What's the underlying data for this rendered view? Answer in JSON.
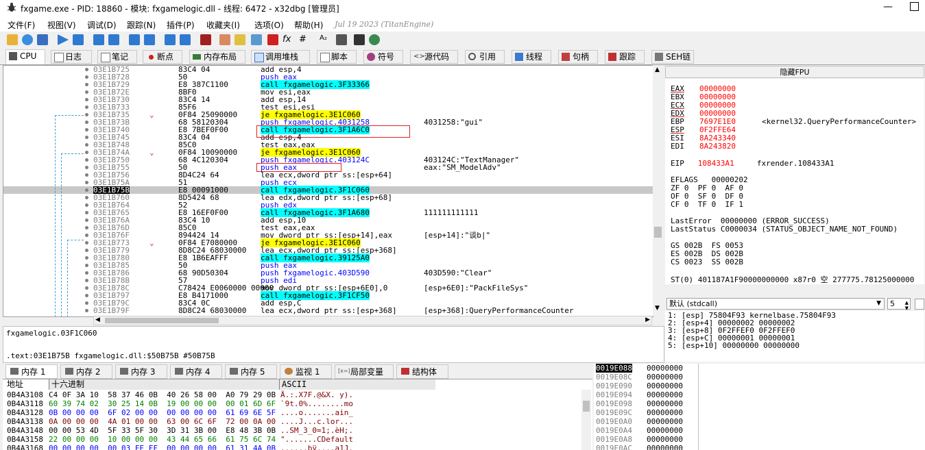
{
  "window": {
    "title": "fxgame.exe - PID: 18860 - 模块: fxgamelogic.dll - 线程: 6472 - x32dbg [管理员]"
  },
  "menu": {
    "items": [
      "文件(F)",
      "视图(V)",
      "调试(D)",
      "跟踪(N)",
      "插件(P)",
      "收藏夹(I)",
      "选项(O)",
      "帮助(H)"
    ],
    "build_date": "Jul 19 2023 (TitanEngine)"
  },
  "tabs": [
    {
      "label": "CPU",
      "icon": "cpu-icon"
    },
    {
      "label": "日志",
      "icon": "log-icon"
    },
    {
      "label": "笔记",
      "icon": "notes-icon"
    },
    {
      "label": "断点",
      "icon": "breakpoint-icon"
    },
    {
      "label": "内存布局",
      "icon": "memory-map-icon"
    },
    {
      "label": "调用堆栈",
      "icon": "call-stack-icon"
    },
    {
      "label": "脚本",
      "icon": "script-icon"
    },
    {
      "label": "符号",
      "icon": "symbols-icon"
    },
    {
      "label": "源代码",
      "icon": "source-icon"
    },
    {
      "label": "引用",
      "icon": "references-icon"
    },
    {
      "label": "线程",
      "icon": "threads-icon"
    },
    {
      "label": "句柄",
      "icon": "handles-icon"
    },
    {
      "label": "跟踪",
      "icon": "trace-icon"
    },
    {
      "label": "SEH链",
      "icon": "seh-icon"
    }
  ],
  "disasm": {
    "rows": [
      {
        "addr": "03E1B725",
        "bytes": "83C4 04",
        "ins": "add esp,4",
        "kind": "plain",
        "cmt": ""
      },
      {
        "addr": "03E1B728",
        "bytes": "50",
        "ins": "push eax",
        "kind": "push",
        "cmt": ""
      },
      {
        "addr": "03E1B729",
        "bytes": "E8 387C1100",
        "ins": "call fxgamelogic.3F33366",
        "kind": "call",
        "cmt": ""
      },
      {
        "addr": "03E1B72E",
        "bytes": "8BF0",
        "ins": "mov esi,eax",
        "kind": "plain",
        "cmt": ""
      },
      {
        "addr": "03E1B730",
        "bytes": "83C4 14",
        "ins": "add esp,14",
        "kind": "plain",
        "cmt": ""
      },
      {
        "addr": "03E1B733",
        "bytes": "85F6",
        "ins": "test esi,esi",
        "kind": "plain",
        "cmt": ""
      },
      {
        "addr": "03E1B735",
        "bytes": "0F84 25090000",
        "ins": "je fxgamelogic.3E1C060",
        "kind": "jmp",
        "cmt": ""
      },
      {
        "addr": "03E1B73B",
        "bytes": "68 58120304",
        "ins": "push fxgamelogic.4031258",
        "kind": "push",
        "cmt": "4031258:\"gui\""
      },
      {
        "addr": "03E1B740",
        "bytes": "E8 7BEF0F00",
        "ins": "call fxgamelogic.3F1A6C0",
        "kind": "call",
        "cmt": ""
      },
      {
        "addr": "03E1B745",
        "bytes": "83C4 04",
        "ins": "add esp,4",
        "kind": "plain",
        "cmt": ""
      },
      {
        "addr": "03E1B748",
        "bytes": "85C0",
        "ins": "test eax,eax",
        "kind": "plain",
        "cmt": ""
      },
      {
        "addr": "03E1B74A",
        "bytes": "0F84 10090000",
        "ins": "je fxgamelogic.3E1C060",
        "kind": "jmp",
        "cmt": ""
      },
      {
        "addr": "03E1B750",
        "bytes": "68 4C120304",
        "ins": "push fxgamelogic.403124C",
        "kind": "push",
        "cmt": "403124C:\"TextManager\""
      },
      {
        "addr": "03E1B755",
        "bytes": "50",
        "ins": "push eax",
        "kind": "push",
        "cmt": "eax:\"SM_ModelAdv\""
      },
      {
        "addr": "03E1B756",
        "bytes": "8D4C24 64",
        "ins": "lea ecx,dword ptr ss:[esp+64]",
        "kind": "plain",
        "cmt": ""
      },
      {
        "addr": "03E1B75A",
        "bytes": "51",
        "ins": "push ecx",
        "kind": "push",
        "cmt": ""
      },
      {
        "addr": "03E1B75B",
        "bytes": "E8 00091000",
        "ins": "call fxgamelogic.3F1C060",
        "kind": "call",
        "cmt": ""
      },
      {
        "addr": "03E1B760",
        "bytes": "8D5424 68",
        "ins": "lea edx,dword ptr ss:[esp+68]",
        "kind": "plain",
        "cmt": ""
      },
      {
        "addr": "03E1B764",
        "bytes": "52",
        "ins": "push edx",
        "kind": "push",
        "cmt": ""
      },
      {
        "addr": "03E1B765",
        "bytes": "E8 16EF0F00",
        "ins": "call fxgamelogic.3F1A680",
        "kind": "call",
        "cmt": "111111111111"
      },
      {
        "addr": "03E1B76A",
        "bytes": "83C4 10",
        "ins": "add esp,10",
        "kind": "plain",
        "cmt": ""
      },
      {
        "addr": "03E1B76D",
        "bytes": "85C0",
        "ins": "test eax,eax",
        "kind": "plain",
        "cmt": ""
      },
      {
        "addr": "03E1B76F",
        "bytes": "894424 14",
        "ins": "mov dword ptr ss:[esp+14],eax",
        "kind": "plain",
        "cmt": "[esp+14]:\"谈b|\""
      },
      {
        "addr": "03E1B773",
        "bytes": "0F84 E7080000",
        "ins": "je fxgamelogic.3E1C060",
        "kind": "jmp",
        "cmt": ""
      },
      {
        "addr": "03E1B779",
        "bytes": "8D8C24 68030000",
        "ins": "lea ecx,dword ptr ss:[esp+368]",
        "kind": "plain",
        "cmt": ""
      },
      {
        "addr": "03E1B780",
        "bytes": "E8 1B6EAFFF",
        "ins": "call fxgamelogic.39125A0",
        "kind": "call",
        "cmt": ""
      },
      {
        "addr": "03E1B785",
        "bytes": "50",
        "ins": "push eax",
        "kind": "push",
        "cmt": ""
      },
      {
        "addr": "03E1B786",
        "bytes": "68 90D50304",
        "ins": "push fxgamelogic.403D590",
        "kind": "push",
        "cmt": "403D590:\"Clear\""
      },
      {
        "addr": "03E1B78B",
        "bytes": "57",
        "ins": "push edi",
        "kind": "push",
        "cmt": ""
      },
      {
        "addr": "03E1B78C",
        "bytes": "C78424 E0060000 00000",
        "ins": "mov dword ptr ss:[esp+6E0],0",
        "kind": "plain",
        "cmt": "[esp+6E0]:\"PackFileSys\""
      },
      {
        "addr": "03E1B797",
        "bytes": "E8 B4171000",
        "ins": "call fxgamelogic.3F1CF50",
        "kind": "call",
        "cmt": ""
      },
      {
        "addr": "03E1B79C",
        "bytes": "83C4 0C",
        "ins": "add esp,C",
        "kind": "plain",
        "cmt": ""
      },
      {
        "addr": "03E1B79F",
        "bytes": "8D8C24 68030000",
        "ins": "lea ecx,dword ptr ss:[esp+368]",
        "kind": "plain",
        "cmt": "[esp+368]:QueryPerformanceCounter"
      }
    ],
    "current_index": 16
  },
  "info": {
    "line1": "fxgamelogic.03F1C060",
    "line2": ".text:03E1B75B fxgamelogic.dll:$50B75B #50B75B"
  },
  "fpu_header": "隐藏FPU",
  "registers": {
    "lines": [
      {
        "name": "EAX",
        "val": "00000000",
        "cmt": ""
      },
      {
        "name": "EBX",
        "val": "00000000",
        "cmt": ""
      },
      {
        "name": "ECX",
        "val": "00000000",
        "cmt": ""
      },
      {
        "name": "EDX",
        "val": "00000000",
        "cmt": ""
      },
      {
        "name": "EBP",
        "val": "7697E1E0",
        "cmt": "<kernel32.QueryPerformanceCounter>"
      },
      {
        "name": "ESP",
        "val": "0F2FFE64",
        "cmt": ""
      },
      {
        "name": "ESI",
        "val": "8A243340",
        "cmt": ""
      },
      {
        "name": "EDI",
        "val": "8A243820",
        "cmt": ""
      }
    ],
    "eip_name": "EIP",
    "eip": "108433A1",
    "eip_cmt": "fxrender.108433A1",
    "eflags": "EFLAGS   00000202",
    "flags1": "ZF 0  PF 0  AF 0",
    "flags2": "OF 0  SF 0  DF 0",
    "flags3": "CF 0  TF 0  IF 1",
    "lasterror": "LastError  00000000 (ERROR_SUCCESS)",
    "laststatus": "LastStatus C0000034 (STATUS_OBJECT_NAME_NOT_FOUND)",
    "seg1": "GS 002B  FS 0053",
    "seg2": "ES 002B  DS 002B",
    "seg3": "CS 0023  SS 002B",
    "st0": "ST(0) 401187A1F90000000000 x87r0 空 277775.78125000000"
  },
  "callconv": {
    "label": "默认 (stdcall)",
    "count": "5"
  },
  "stack_args": [
    "1: [esp] 75804F93 kernelbase.75804F93",
    "2: [esp+4] 00000002 00000002",
    "3: [esp+8] 0F2FFEF0 0F2FFEF0",
    "4: [esp+C] 00000001 00000001",
    "5: [esp+10] 00000000 00000000"
  ],
  "mem_tabs": [
    {
      "label": "内存 1"
    },
    {
      "label": "内存 2"
    },
    {
      "label": "内存 3"
    },
    {
      "label": "内存 4"
    },
    {
      "label": "内存 5"
    },
    {
      "label": "监视 1"
    },
    {
      "label": "局部变量"
    },
    {
      "label": "结构体"
    }
  ],
  "dump": {
    "col_addr": "地址",
    "col_hex": "十六进制",
    "col_ascii": "ASCII",
    "rows": [
      {
        "addr": "0B4A3108",
        "hex": "C4 0F 3A 10  58 37 46 0B  40 26 58 00  A0 79 29 0B",
        "ascii": "Ä.:.X7F.@&X. y)."
      },
      {
        "addr": "0B4A3118",
        "hex": "60 39 74 02  30 25 14 0B  19 00 00 00  00 01 6D 6F",
        "ascii": "`9t.0%........mo"
      },
      {
        "addr": "0B4A3128",
        "hex": "0B 00 00 00  6F 02 00 00  00 00 00 00  61 69 6E 5F",
        "ascii": "....o.......ain_"
      },
      {
        "addr": "0B4A3138",
        "hex": "0A 00 00 00  4A 01 00 00  63 00 6C 6F  72 00 0A 00",
        "ascii": "....J...c.lor..."
      },
      {
        "addr": "0B4A3148",
        "hex": "00 00 53 4D  5F 33 5F 30  3D 31 3B 00  E8 48 3B 0B",
        "ascii": "..SM_3_0=1;.èH;."
      },
      {
        "addr": "0B4A3158",
        "hex": "22 00 00 00  10 00 00 00  43 44 65 66  61 75 6C 74",
        "ascii": "\".......CDefault"
      },
      {
        "addr": "0B4A3168",
        "hex": "00 00 00 00  00 03 FE FF  00 00 00 00  61 31 4A 0B",
        "ascii": "......bÿ....a1J."
      }
    ]
  },
  "stack": {
    "rows": [
      {
        "addr": "0019E088",
        "val": "00000000"
      },
      {
        "addr": "0019E08C",
        "val": "00000000"
      },
      {
        "addr": "0019E090",
        "val": "00000000"
      },
      {
        "addr": "0019E094",
        "val": "00000000"
      },
      {
        "addr": "0019E098",
        "val": "00000000"
      },
      {
        "addr": "0019E09C",
        "val": "00000000"
      },
      {
        "addr": "0019E0A0",
        "val": "00000000"
      },
      {
        "addr": "0019E0A4",
        "val": "00000000"
      },
      {
        "addr": "0019E0A8",
        "val": "00000000"
      },
      {
        "addr": "0019E0AC",
        "val": "00000000"
      }
    ]
  },
  "colors": {
    "call_bg": "#00ffff",
    "jmp_bg": "#ffff00",
    "register_value": "#ff0000",
    "highlight_box": "#e02020",
    "jump_arrow": "#3aa0d8"
  }
}
